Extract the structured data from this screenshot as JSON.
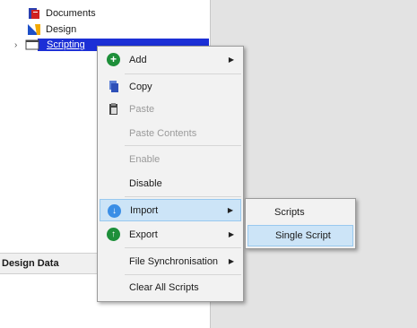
{
  "tree": {
    "items": [
      {
        "label": "Documents"
      },
      {
        "label": "Design"
      },
      {
        "label": "Scripting"
      }
    ]
  },
  "panel": {
    "design_data_title": "Design Data"
  },
  "context_menu": {
    "items": [
      {
        "label": "Add",
        "icon": "add-icon",
        "enabled": true,
        "submenu": true
      },
      {
        "label": "Copy",
        "icon": "copy-icon",
        "enabled": true,
        "submenu": false
      },
      {
        "label": "Paste",
        "icon": "paste-icon",
        "enabled": false,
        "submenu": false
      },
      {
        "label": "Paste Contents",
        "icon": "",
        "enabled": false,
        "submenu": false
      },
      {
        "label": "Enable",
        "icon": "",
        "enabled": false,
        "submenu": false
      },
      {
        "label": "Disable",
        "icon": "",
        "enabled": true,
        "submenu": false
      },
      {
        "label": "Import",
        "icon": "import-icon",
        "enabled": true,
        "submenu": true,
        "highlighted": true
      },
      {
        "label": "Export",
        "icon": "export-icon",
        "enabled": true,
        "submenu": true
      },
      {
        "label": "File Synchronisation",
        "icon": "",
        "enabled": true,
        "submenu": true
      },
      {
        "label": "Clear All Scripts",
        "icon": "",
        "enabled": true,
        "submenu": false
      }
    ]
  },
  "import_submenu": {
    "items": [
      {
        "label": "Scripts"
      },
      {
        "label": "Single Script",
        "highlighted": true
      }
    ]
  },
  "colors": {
    "selection": "#1c2fd6",
    "menu_hover": "#cce4f7",
    "add_green": "#1e8f3a",
    "import_blue": "#3a8ee6",
    "export_green": "#1e8f3a"
  }
}
